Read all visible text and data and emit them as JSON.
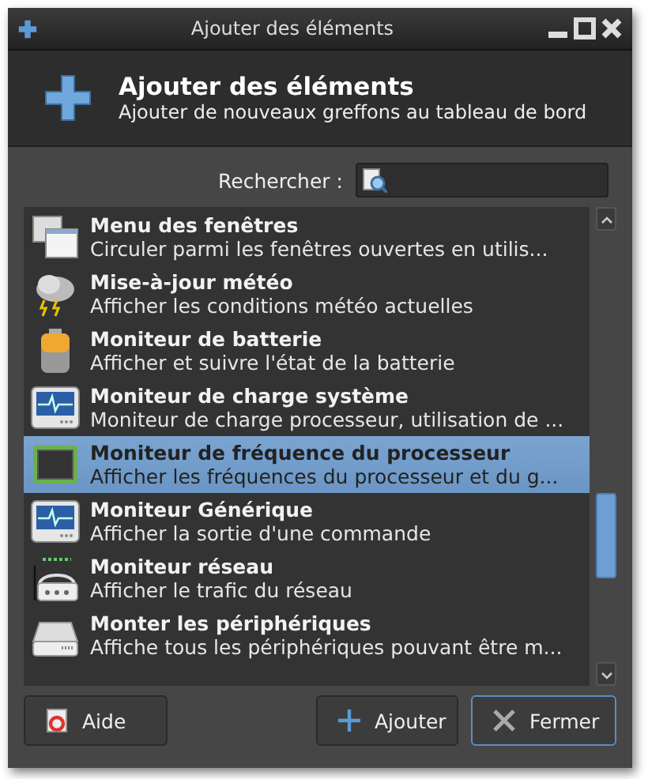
{
  "window": {
    "title": "Ajouter des éléments"
  },
  "header": {
    "title": "Ajouter des éléments",
    "subtitle": "Ajouter de nouveaux greffons au tableau de bord"
  },
  "search": {
    "label": "Rechercher :"
  },
  "items": [
    {
      "kind": "windows",
      "name": "Menu des fenêtres",
      "description": "Circuler parmi les fenêtres ouvertes en utilis...",
      "selected": false
    },
    {
      "kind": "weather",
      "name": "Mise-à-jour météo",
      "description": "Afficher les conditions météo actuelles",
      "selected": false
    },
    {
      "kind": "battery",
      "name": "Moniteur de batterie",
      "description": "Afficher et suivre l'état de la batterie",
      "selected": false
    },
    {
      "kind": "monitor",
      "name": "Moniteur de charge système",
      "description": "Moniteur de charge processeur, utilisation de ...",
      "selected": false
    },
    {
      "kind": "cpu",
      "name": "Moniteur de fréquence du processeur",
      "description": "Afficher les fréquences du processeur et du g...",
      "selected": true
    },
    {
      "kind": "monitor",
      "name": "Moniteur Générique",
      "description": "Afficher la sortie d'une commande",
      "selected": false
    },
    {
      "kind": "router",
      "name": "Moniteur réseau",
      "description": "Afficher le trafic du réseau",
      "selected": false
    },
    {
      "kind": "drive",
      "name": "Monter les périphériques",
      "description": "Affiche tous les périphériques pouvant être m...",
      "selected": false
    }
  ],
  "buttons": [
    {
      "kind": "help",
      "label": "Aide"
    },
    {
      "kind": "add",
      "label": "Ajouter"
    },
    {
      "kind": "close",
      "label": "Fermer"
    }
  ]
}
